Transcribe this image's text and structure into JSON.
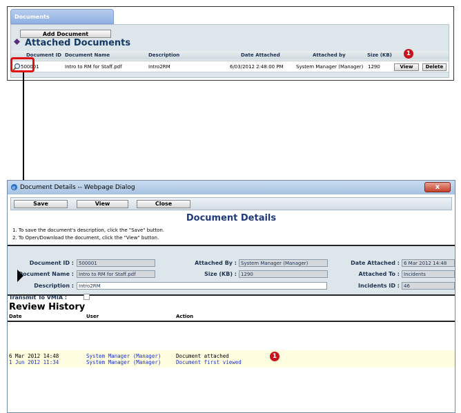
{
  "top_panel": {
    "tab_label": "Documents",
    "add_button": "Add Document",
    "section_title": "Attached Documents",
    "columns": [
      "Document ID",
      "Document Name",
      "Description",
      "Date Attached",
      "Attached by",
      "Size (KB)"
    ],
    "row": {
      "id": "500001",
      "name": "Intro to RM for Staff.pdf",
      "description": "Intro2RM",
      "date_attached": "6/03/2012 2:48:00 PM",
      "attached_by": "System Manager (Manager)",
      "size": "1290"
    },
    "view_button": "View",
    "delete_button": "Delete",
    "badge": "1"
  },
  "dialog": {
    "title": "Document Details -- Webpage Dialog",
    "close_glyph": "x",
    "toolbar": {
      "save": "Save",
      "view": "View",
      "close": "Close"
    },
    "heading": "Document Details",
    "instructions": [
      "1.  To save the document's description, click the \"Save\" button.",
      "2.  To Open/Download the document, click the  \"View\" button."
    ],
    "form": {
      "document_id_label": "Document ID :",
      "document_id": "500001",
      "document_name_label": "Document Name :",
      "document_name": "Intro to RM for Staff.pdf",
      "description_label": "Description :",
      "description": "Intro2RM",
      "transmit_label": "Transmit To VMIA :",
      "attached_by_label": "Attached By :",
      "attached_by": "System Manager (Manager)",
      "size_label": "Size (KB) :",
      "size": "1290",
      "date_attached_label": "Date Attached :",
      "date_attached": "6 Mar 2012 14:48",
      "attached_to_label": "Attached To :",
      "attached_to": "Incidents",
      "incidents_id_label": "Incidents ID :",
      "incidents_id": "46"
    },
    "review": {
      "title": "Review History",
      "columns": [
        "Date",
        "User",
        "Action"
      ],
      "rows": [
        {
          "date": "6 Mar 2012 14:48",
          "user": "System Manager (Manager)",
          "action": "Document attached"
        },
        {
          "date": "1 Jun 2012 11:34",
          "user": "System Manager (Manager)",
          "action": "Document first viewed"
        }
      ],
      "badge": "1"
    }
  },
  "colors": {
    "accent_red": "#c8151b",
    "heading_blue": "#1f3a78",
    "panel_bg": "#dde6ea",
    "row_blue": "#1a2fd1"
  }
}
